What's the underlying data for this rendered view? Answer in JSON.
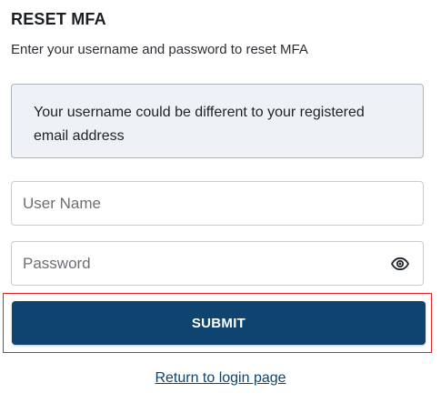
{
  "header": {
    "title": "RESET MFA",
    "subtitle": "Enter your username and password to reset MFA"
  },
  "info": {
    "message": "Your username could be different to your registered email address"
  },
  "form": {
    "username": {
      "value": "",
      "placeholder": "User Name"
    },
    "password": {
      "value": "",
      "placeholder": "Password",
      "toggle_icon": "eye-icon"
    },
    "submit_label": "SUBMIT",
    "highlight_color": "#e02424",
    "button_color": "#0f4471"
  },
  "footer": {
    "return_link": "Return to login page"
  }
}
